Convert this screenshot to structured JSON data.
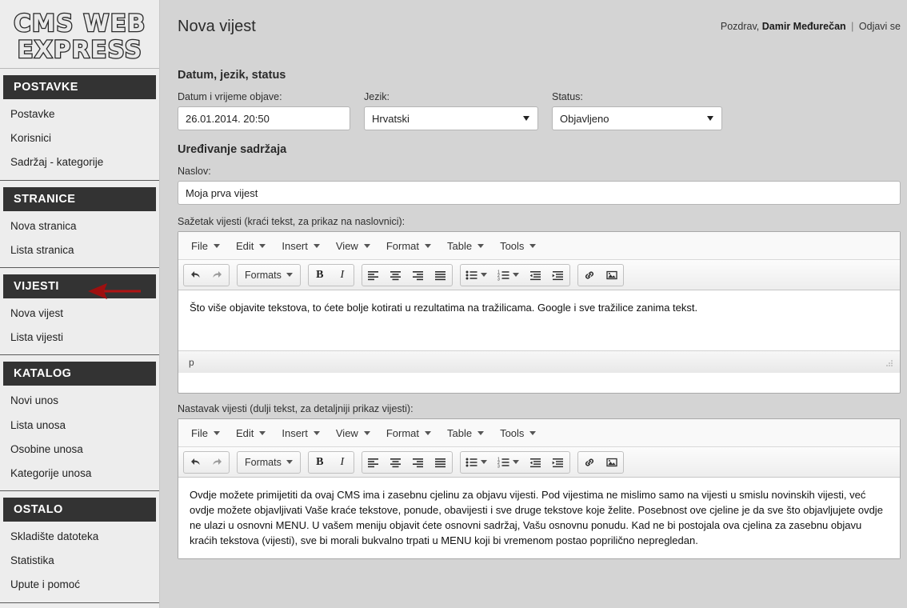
{
  "logo": {
    "line1": "CMS WEB",
    "line2": "EXPRESS"
  },
  "sidebar": {
    "sections": [
      {
        "header": "POSTAVKE",
        "items": [
          "Postavke",
          "Korisnici",
          "Sadržaj - kategorije"
        ]
      },
      {
        "header": "STRANICE",
        "items": [
          "Nova stranica",
          "Lista stranica"
        ]
      },
      {
        "header": "VIJESTI",
        "items": [
          "Nova vijest",
          "Lista vijesti"
        ]
      },
      {
        "header": "KATALOG",
        "items": [
          "Novi unos",
          "Lista unosa",
          "Osobine unosa",
          "Kategorije unosa"
        ]
      },
      {
        "header": "OSTALO",
        "items": [
          "Skladište datoteka",
          "Statistika",
          "Upute i pomoć"
        ]
      }
    ],
    "annotation_arrow_target": "Nova vijest",
    "annotation_arrow_color": "#b01414",
    "header_bg": "#333333"
  },
  "header": {
    "title": "Nova vijest",
    "greeting": "Pozdrav,",
    "username": "Damir Međurečan",
    "separator": "|",
    "logout": "Odjavi se"
  },
  "sections": {
    "meta_title": "Datum, jezik, status",
    "content_title": "Uređivanje sadržaja"
  },
  "fields": {
    "date": {
      "label": "Datum i vrijeme objave:",
      "value": "26.01.2014. 20:50"
    },
    "language": {
      "label": "Jezik:",
      "value": "Hrvatski"
    },
    "status": {
      "label": "Status:",
      "value": "Objavljeno"
    },
    "title": {
      "label": "Naslov:",
      "value": "Moja prva vijest"
    },
    "summary": {
      "label": "Sažetak vijesti (kraći tekst, za prikaz na naslovnici):"
    },
    "body": {
      "label": "Nastavak vijesti (dulji tekst, za detaljniji prikaz vijesti):"
    }
  },
  "editor": {
    "menubar": [
      "File",
      "Edit",
      "Insert",
      "View",
      "Format",
      "Table",
      "Tools"
    ],
    "formats_label": "Formats",
    "bold_label": "B",
    "italic_label": "I",
    "statusbar_path": "p",
    "icons": [
      "undo-icon",
      "redo-icon",
      "formats-dropdown",
      "bold-icon",
      "italic-icon",
      "align-left-icon",
      "align-center-icon",
      "align-right-icon",
      "align-justify-icon",
      "bullet-list-icon",
      "numbered-list-icon",
      "outdent-icon",
      "indent-icon",
      "link-icon",
      "image-icon"
    ]
  },
  "editor1_content": "Što više objavite tekstova, to ćete bolje kotirati u rezultatima na tražilicama. Google i sve tražilice zanima tekst.",
  "editor2_content": "Ovdje možete primijetiti da ovaj CMS ima i zasebnu cjelinu za objavu vijesti. Pod vijestima ne mislimo samo na vijesti u smislu novinskih vijesti, već ovdje možete objavljivati Vaše kraće tekstove, ponude, obavijesti i sve druge tekstove koje želite. Posebnost ove cjeline je da sve što objavljujete ovdje ne ulazi u osnovni MENU. U vašem meniju objavit ćete osnovni sadržaj, Vašu osnovnu ponudu. Kad ne bi postojala ova cjelina za zasebnu objavu kraćih tekstova (vijesti), sve bi morali bukvalno trpati u MENU koji bi vremenom postao poprilično nepregledan."
}
